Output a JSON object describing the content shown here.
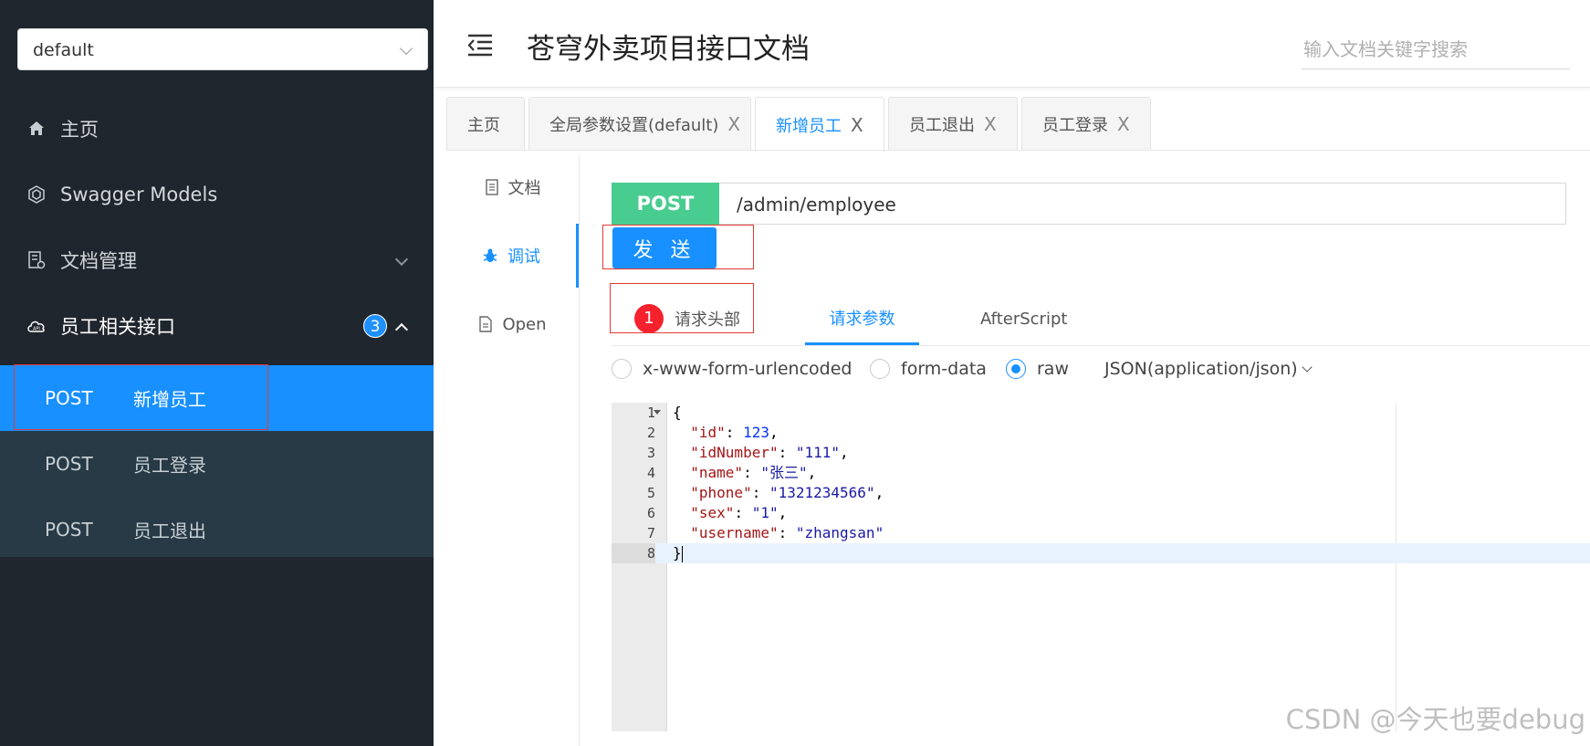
{
  "sidebar": {
    "group_select": "default",
    "items": [
      {
        "label": "主页",
        "icon": "home-icon"
      },
      {
        "label": "Swagger Models",
        "icon": "models-icon"
      },
      {
        "label": "文档管理",
        "icon": "doc-settings-icon"
      },
      {
        "label": "员工相关接口",
        "icon": "cloud-api-icon",
        "badge": "3"
      }
    ],
    "sub_items": [
      {
        "method": "POST",
        "name": "新增员工",
        "active": true
      },
      {
        "method": "POST",
        "name": "员工登录"
      },
      {
        "method": "POST",
        "name": "员工退出"
      }
    ]
  },
  "header": {
    "title": "苍穹外卖项目接口文档",
    "search_placeholder": "输入文档关键字搜索"
  },
  "tabs": [
    {
      "label": "主页"
    },
    {
      "label": "全局参数设置(default)",
      "close": "X"
    },
    {
      "label": "新增员工",
      "close": "X",
      "active": true
    },
    {
      "label": "员工退出",
      "close": "X"
    },
    {
      "label": "员工登录",
      "close": "X"
    }
  ],
  "side_tabs": [
    {
      "label": "文档"
    },
    {
      "label": "调试",
      "active": true
    },
    {
      "label": "Open"
    }
  ],
  "request": {
    "method": "POST",
    "url": "/admin/employee",
    "send_label": "发 送"
  },
  "param_tabs": {
    "headers_badge": "1",
    "headers_label": "请求头部",
    "params_label": "请求参数",
    "afterscript_label": "AfterScript"
  },
  "body_types": {
    "options": [
      "x-www-form-urlencoded",
      "form-data",
      "raw"
    ],
    "selected": "raw",
    "content_type": "JSON(application/json)"
  },
  "editor": {
    "line_numbers": [
      "1",
      "2",
      "3",
      "4",
      "5",
      "6",
      "7",
      "8"
    ],
    "body": {
      "id": "123",
      "idNumber": "111",
      "name": "张三",
      "phone": "1321234566",
      "sex": "1",
      "username": "zhangsan"
    }
  },
  "watermark": "CSDN @今天也要debug",
  "colors": {
    "sidebar_bg": "#1f262d",
    "accent": "#1890ff",
    "post": "#49cc90",
    "badge_red": "#f5222d"
  }
}
